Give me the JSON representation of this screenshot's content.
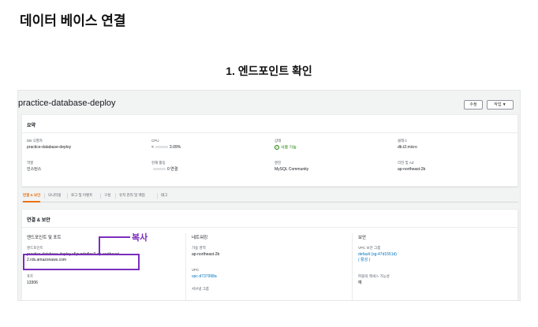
{
  "page": {
    "title": "데이터 베이스 연결",
    "step_title": "1. 엔드포인트 확인",
    "annotation_label": "복사",
    "annotation_color": "#7b2ebd"
  },
  "db": {
    "name": "practice-database-deploy",
    "buttons": {
      "edit": "수정",
      "actions": "작업 ▼"
    }
  },
  "summary": {
    "heading": "요약",
    "fields": {
      "db_id": {
        "label": "DB 식별자",
        "value": "practice-database-deploy"
      },
      "cpu": {
        "label": "CPU",
        "value": "3.09%",
        "prefix": "<"
      },
      "status": {
        "label": "상태",
        "value": "사용 가능"
      },
      "class": {
        "label": "클래스",
        "value": "db.t2.micro"
      },
      "role": {
        "label": "역할",
        "value": "인스턴스"
      },
      "activity": {
        "label": "현재 활동",
        "value": "0 연결"
      },
      "engine": {
        "label": "엔진",
        "value": "MySQL Community"
      },
      "region": {
        "label": "리전 및 AZ",
        "value": "ap-northeast-2b"
      }
    }
  },
  "tabs": [
    "연결 & 보안",
    "모니터링",
    "로그 및 이벤트",
    "구성",
    "유지 관리 및 백업",
    "태그"
  ],
  "connectivity": {
    "heading": "연결 & 보안",
    "endpoint_col": {
      "title": "엔드포인트 및 포트",
      "endpoint_label": "엔드포인트",
      "endpoint_line1": "practice-database-deploy.c5pvzdzdlnc3.ap-northeast-",
      "endpoint_line2": "2.rds.amazonaws.com",
      "port_label": "포트",
      "port_value": "13306"
    },
    "network_col": {
      "title": "네트워킹",
      "az_label": "가용 영역",
      "az_value": "ap-northeast-2b",
      "vpc_label": "VPC",
      "vpc_value": "vpc-d737998a",
      "subnet_label": "서브넷 그룹"
    },
    "security_col": {
      "title": "보안",
      "sg_label": "VPC 보안 그룹",
      "sg_value": "default (sg-47d1551d)",
      "sg_status": "( 활성 )",
      "public_label": "퍼블릭 액세스 가능성",
      "public_value": "예"
    }
  },
  "colors": {
    "accent_tab": "#ec7211",
    "link": "#0073bb",
    "status_ok": "#1d8102"
  }
}
